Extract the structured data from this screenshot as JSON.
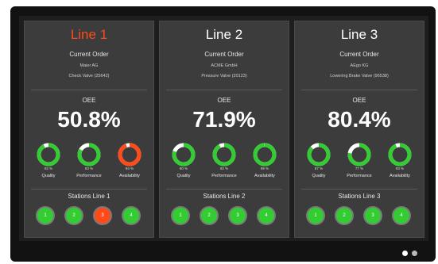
{
  "colors": {
    "ok": "#33cc33",
    "alarm": "#ff4a1a",
    "track": "#ffffff",
    "title_active": "#ff4a1a"
  },
  "labels": {
    "current_order": "Current Order",
    "oee": "OEE"
  },
  "lines": [
    {
      "title": "Line 1",
      "title_active": true,
      "customer": "Maier AG",
      "product": "Check Valve (25642)",
      "oee": "50.8%",
      "gauges": [
        {
          "pct": "92 %",
          "value": 0.92,
          "label": "Quality",
          "status": "ok"
        },
        {
          "pct": "83 %",
          "value": 0.83,
          "label": "Performance",
          "status": "ok"
        },
        {
          "pct": "94 %",
          "value": 0.94,
          "label": "Availability",
          "status": "alarm"
        }
      ],
      "stations_title": "Stations Line 1",
      "stations": [
        {
          "num": "1",
          "status": "ok"
        },
        {
          "num": "2",
          "status": "ok"
        },
        {
          "num": "3",
          "status": "alarm"
        },
        {
          "num": "4",
          "status": "ok"
        }
      ]
    },
    {
      "title": "Line 2",
      "title_active": false,
      "customer": "ACME GmbH",
      "product": "Pressure Valve (20123)",
      "oee": "71.9%",
      "gauges": [
        {
          "pct": "80 %",
          "value": 0.8,
          "label": "Quality",
          "status": "ok"
        },
        {
          "pct": "92 %",
          "value": 0.92,
          "label": "Performance",
          "status": "ok"
        },
        {
          "pct": "99 %",
          "value": 0.99,
          "label": "Availability",
          "status": "ok"
        }
      ],
      "stations_title": "Stations Line 2",
      "stations": [
        {
          "num": "1",
          "status": "ok"
        },
        {
          "num": "2",
          "status": "ok"
        },
        {
          "num": "3",
          "status": "ok"
        },
        {
          "num": "4",
          "status": "ok"
        }
      ]
    },
    {
      "title": "Line 3",
      "title_active": false,
      "customer": "AEgo KG",
      "product": "Lowering Brake Valve (96538)",
      "oee": "80.4%",
      "gauges": [
        {
          "pct": "87 %",
          "value": 0.87,
          "label": "Quality",
          "status": "ok"
        },
        {
          "pct": "77 %",
          "value": 0.77,
          "label": "Performance",
          "status": "ok"
        },
        {
          "pct": "93 %",
          "value": 0.93,
          "label": "Availability",
          "status": "ok"
        }
      ],
      "stations_title": "Stations Line 3",
      "stations": [
        {
          "num": "1",
          "status": "ok"
        },
        {
          "num": "2",
          "status": "ok"
        },
        {
          "num": "3",
          "status": "ok"
        },
        {
          "num": "4",
          "status": "ok"
        }
      ]
    }
  ],
  "pager": {
    "pages": 2,
    "active": 1
  }
}
